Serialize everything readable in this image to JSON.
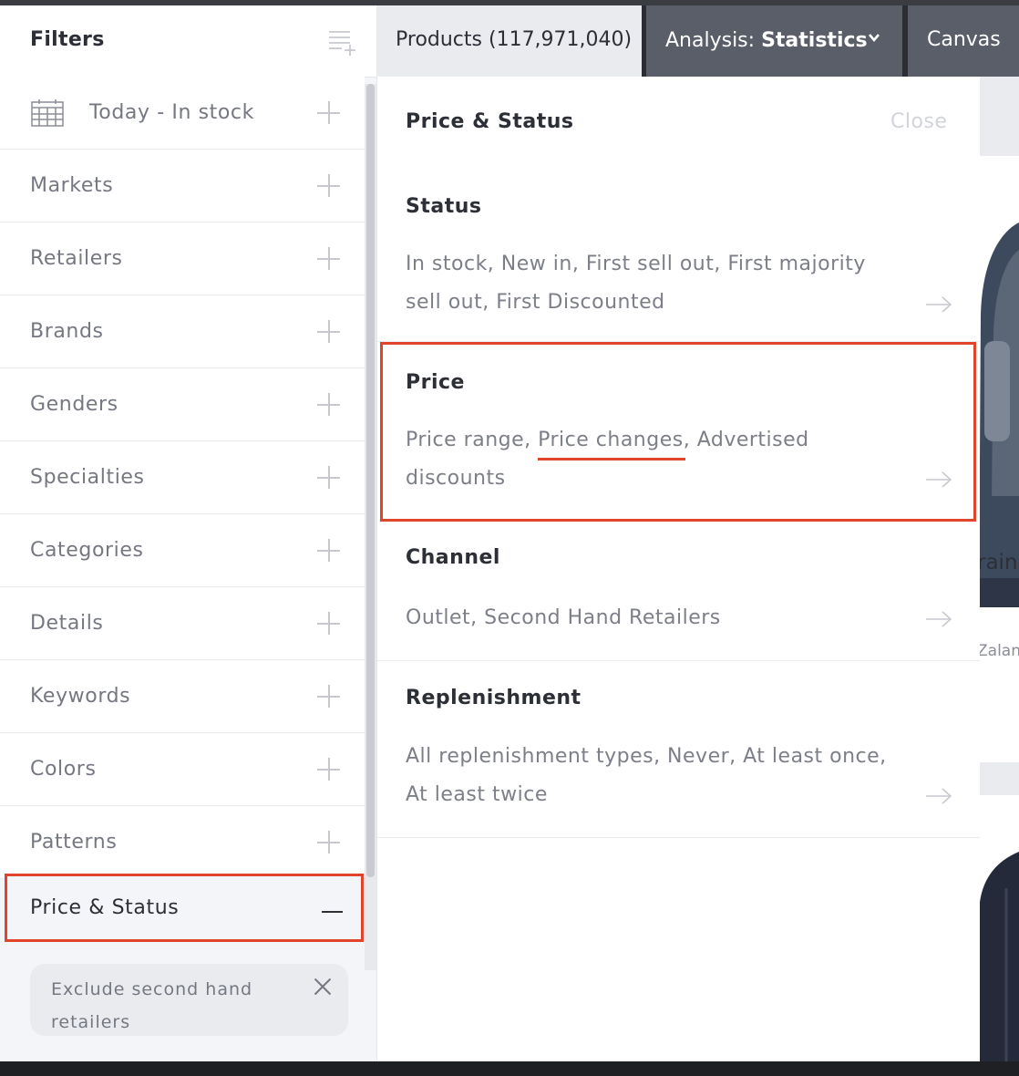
{
  "sidebar": {
    "title": "Filters",
    "items": [
      {
        "label": "Today - In stock"
      },
      {
        "label": "Markets"
      },
      {
        "label": "Retailers"
      },
      {
        "label": "Brands"
      },
      {
        "label": "Genders"
      },
      {
        "label": "Specialties"
      },
      {
        "label": "Categories"
      },
      {
        "label": "Details"
      },
      {
        "label": "Keywords"
      },
      {
        "label": "Colors"
      },
      {
        "label": "Patterns"
      }
    ],
    "active_item": "Price & Status",
    "chip": "Exclude second hand retailers"
  },
  "tabs": {
    "products": "Products (117,971,040)",
    "analysis_prefix": "Analysis:",
    "analysis_value": "Statistics",
    "canvas": "Canvas"
  },
  "panel": {
    "title": "Price & Status",
    "close": "Close",
    "sections": [
      {
        "title": "Status",
        "desc": "In stock, New in, First sell out, First majority sell out, First Discounted"
      },
      {
        "title": "Price",
        "desc_before": "Price range, ",
        "desc_highlight": "Price changes",
        "desc_after": ", Advertised discounts"
      },
      {
        "title": "Channel",
        "desc": "Outlet, Second Hand Retailers"
      },
      {
        "title": "Replenishment",
        "desc": "All replenishment types, Never, At least once, At least twice"
      }
    ]
  },
  "background": {
    "product_name_fragment": "raine",
    "retailer_fragment": "Zalan"
  },
  "colors": {
    "highlight": "#e0452c",
    "tab_dark": "#5a5e68",
    "sidebar_bg": "#f4f5f8"
  }
}
